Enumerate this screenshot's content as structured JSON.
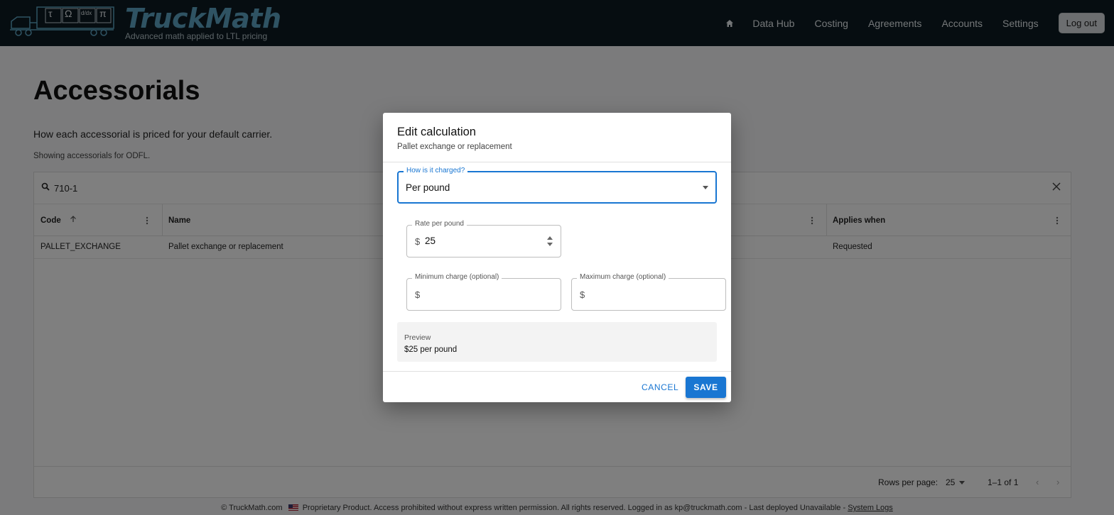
{
  "header": {
    "brand_name": "TruckMath",
    "brand_tagline": "Advanced math applied to LTL pricing",
    "logo_symbols": [
      "τ",
      "Ω",
      "d/dx",
      "π"
    ],
    "nav": [
      {
        "label": "Data Hub"
      },
      {
        "label": "Costing"
      },
      {
        "label": "Agreements"
      },
      {
        "label": "Accounts"
      },
      {
        "label": "Settings"
      }
    ],
    "logout_label": "Log out"
  },
  "page": {
    "title": "Accessorials",
    "description": "How each accessorial is priced for your default carrier.",
    "subtitle": "Showing accessorials for ODFL."
  },
  "grid": {
    "search_value": "710-1",
    "columns": [
      "Code",
      "Name",
      "Applies when"
    ],
    "rows": [
      {
        "code": "PALLET_EXCHANGE",
        "name": "Pallet exchange or replacement",
        "applies_when": "Requested"
      }
    ],
    "rows_per_page_label": "Rows per page:",
    "rows_per_page_value": "25",
    "pagination": "1–1 of 1"
  },
  "footer": {
    "copyright": "© TruckMath.com",
    "notice": "Proprietary Product. Access prohibited without express written permission. All rights reserved. Logged in as kp@truckmath.com - Last deployed Unavailable -",
    "link": "System Logs"
  },
  "dialog": {
    "title": "Edit calculation",
    "subtitle": "Pallet exchange or replacement",
    "charge_label": "How is it charged?",
    "charge_value": "Per pound",
    "rate_label": "Rate per pound",
    "rate_value": "25",
    "min_label": "Minimum charge (optional)",
    "max_label": "Maximum charge (optional)",
    "currency_symbol": "$",
    "preview_label": "Preview",
    "preview_value": "$25 per pound",
    "cancel_label": "CANCEL",
    "save_label": "SAVE"
  },
  "colors": {
    "header_bg": "#0d1b22",
    "brand": "#5fa6c6",
    "accent": "#1976d2"
  }
}
